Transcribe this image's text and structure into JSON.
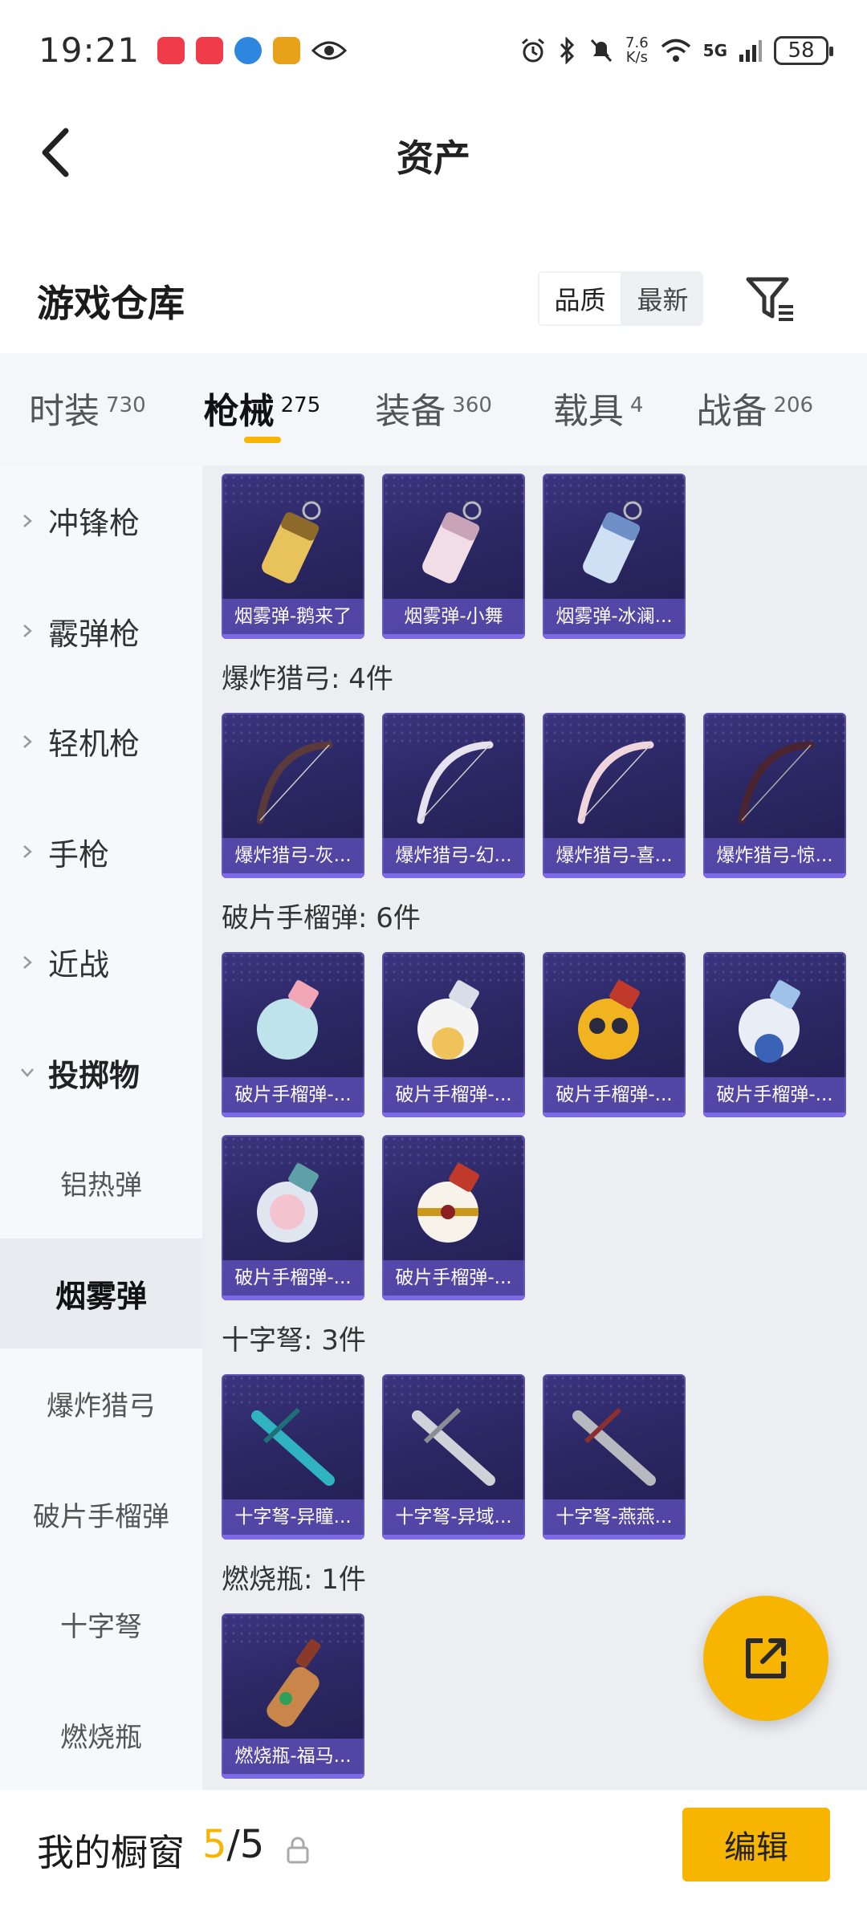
{
  "status_bar": {
    "time": "19:21",
    "net_speed_value": "7.6",
    "net_speed_unit": "K/s",
    "signal": "5G",
    "battery": "58"
  },
  "header": {
    "title": "资产"
  },
  "warehouse": {
    "title": "游戏仓库",
    "sort_options": [
      "品质",
      "最新"
    ],
    "selected_sort": "品质"
  },
  "tabs": [
    {
      "label": "时装",
      "count": "730"
    },
    {
      "label": "枪械",
      "count": "275",
      "active": true
    },
    {
      "label": "装备",
      "count": "360"
    },
    {
      "label": "载具",
      "count": "4"
    },
    {
      "label": "战备",
      "count": "206"
    }
  ],
  "sidebar": {
    "items": [
      {
        "label": "冲锋枪"
      },
      {
        "label": "霰弹枪"
      },
      {
        "label": "轻机枪"
      },
      {
        "label": "手枪"
      },
      {
        "label": "近战"
      },
      {
        "label": "投掷物"
      },
      {
        "label": "铝热弹"
      },
      {
        "label": "烟雾弹"
      },
      {
        "label": "爆炸猎弓"
      },
      {
        "label": "破片手榴弹"
      },
      {
        "label": "十字弩"
      },
      {
        "label": "燃烧瓶"
      }
    ]
  },
  "content": {
    "smoke_items": [
      "烟雾弹-鹅来了",
      "烟雾弹-小舞",
      "烟雾弹-冰澜..."
    ],
    "bow_group_title": "爆炸猎弓: 4件",
    "bow_items": [
      "爆炸猎弓-灰...",
      "爆炸猎弓-幻...",
      "爆炸猎弓-喜...",
      "爆炸猎弓-惊..."
    ],
    "grenade_group_title": "破片手榴弹: 6件",
    "grenade_items": [
      "破片手榴弹-...",
      "破片手榴弹-...",
      "破片手榴弹-...",
      "破片手榴弹-...",
      "破片手榴弹-...",
      "破片手榴弹-..."
    ],
    "crossbow_group_title": "十字弩: 3件",
    "crossbow_items": [
      "十字弩-异瞳...",
      "十字弩-异域...",
      "十字弩-燕燕..."
    ],
    "molotov_group_title": "燃烧瓶: 1件",
    "molotov_items": [
      "燃烧瓶-福马..."
    ]
  },
  "bottom": {
    "showcase_label": "我的橱窗",
    "showcase_current": "5",
    "showcase_separator": "/",
    "showcase_total": "5",
    "edit_label": "编辑"
  },
  "colors": {
    "accent": "#f7b500",
    "card_bg": "#2a2762",
    "caption_bg": "#7c6ae6"
  }
}
